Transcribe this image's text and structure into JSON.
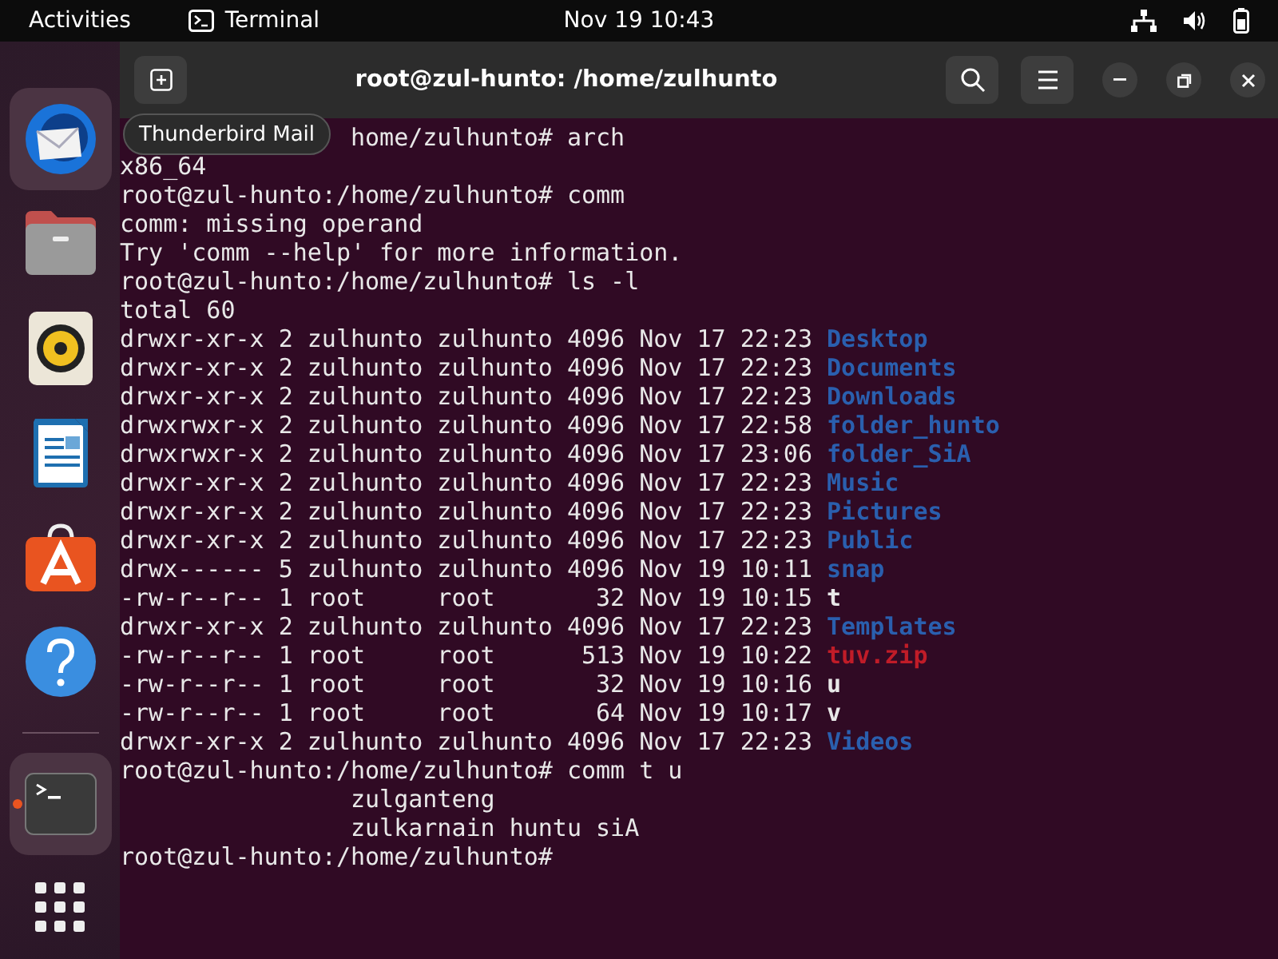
{
  "top_bar": {
    "activities": "Activities",
    "app_name": "Terminal",
    "clock": "Nov 19  10:43"
  },
  "dock": {
    "items": [
      {
        "kind": "mail",
        "highlighted": true,
        "running": false
      },
      {
        "kind": "files",
        "highlighted": false,
        "running": false
      },
      {
        "kind": "music",
        "highlighted": false,
        "running": false
      },
      {
        "kind": "writer",
        "highlighted": false,
        "running": false
      },
      {
        "kind": "store",
        "highlighted": false,
        "running": false
      },
      {
        "kind": "help",
        "highlighted": false,
        "running": false
      }
    ],
    "others": [
      {
        "kind": "terminal",
        "highlighted": true,
        "running": true
      },
      {
        "kind": "apps",
        "highlighted": false,
        "running": false
      }
    ],
    "tooltip": "Thunderbird Mail"
  },
  "window": {
    "title": "root@zul-hunto: /home/zulhunto"
  },
  "terminal": {
    "lines": [
      {
        "kind": "covered",
        "text": "home/zulhunto# arch"
      },
      {
        "kind": "plain",
        "text": "x86_64"
      },
      {
        "kind": "plain",
        "text": "root@zul-hunto:/home/zulhunto# comm"
      },
      {
        "kind": "plain",
        "text": "comm: missing operand"
      },
      {
        "kind": "plain",
        "text": "Try 'comm --help' for more information."
      },
      {
        "kind": "plain",
        "text": "root@zul-hunto:/home/zulhunto# ls -l"
      },
      {
        "kind": "plain",
        "text": "total 60"
      },
      {
        "kind": "entry",
        "text": "drwxr-xr-x 2 zulhunto zulhunto 4096 Nov 17 22:23",
        "name": "Desktop",
        "color": "#2a5fae"
      },
      {
        "kind": "entry",
        "text": "drwxr-xr-x 2 zulhunto zulhunto 4096 Nov 17 22:23",
        "name": "Documents",
        "color": "#2a5fae"
      },
      {
        "kind": "entry",
        "text": "drwxr-xr-x 2 zulhunto zulhunto 4096 Nov 17 22:23",
        "name": "Downloads",
        "color": "#2a5fae"
      },
      {
        "kind": "entry",
        "text": "drwxrwxr-x 2 zulhunto zulhunto 4096 Nov 17 22:58",
        "name": "folder_hunto",
        "color": "#2a5fae"
      },
      {
        "kind": "entry",
        "text": "drwxrwxr-x 2 zulhunto zulhunto 4096 Nov 17 23:06",
        "name": "folder_SiA",
        "color": "#2a5fae"
      },
      {
        "kind": "entry",
        "text": "drwxr-xr-x 2 zulhunto zulhunto 4096 Nov 17 22:23",
        "name": "Music",
        "color": "#2a5fae"
      },
      {
        "kind": "entry",
        "text": "drwxr-xr-x 2 zulhunto zulhunto 4096 Nov 17 22:23",
        "name": "Pictures",
        "color": "#2a5fae"
      },
      {
        "kind": "entry",
        "text": "drwxr-xr-x 2 zulhunto zulhunto 4096 Nov 17 22:23",
        "name": "Public",
        "color": "#2a5fae"
      },
      {
        "kind": "entry",
        "text": "drwx------ 5 zulhunto zulhunto 4096 Nov 19 10:11",
        "name": "snap",
        "color": "#2a5fae"
      },
      {
        "kind": "entry",
        "text": "-rw-r--r-- 1 root     root       32 Nov 19 10:15",
        "name": "t",
        "color": "#e8e8e8"
      },
      {
        "kind": "entry",
        "text": "drwxr-xr-x 2 zulhunto zulhunto 4096 Nov 17 22:23",
        "name": "Templates",
        "color": "#2a5fae"
      },
      {
        "kind": "entry",
        "text": "-rw-r--r-- 1 root     root      513 Nov 19 10:22",
        "name": "tuv.zip",
        "color": "#c01c28"
      },
      {
        "kind": "entry",
        "text": "-rw-r--r-- 1 root     root       32 Nov 19 10:16",
        "name": "u",
        "color": "#e8e8e8"
      },
      {
        "kind": "entry",
        "text": "-rw-r--r-- 1 root     root       64 Nov 19 10:17",
        "name": "v",
        "color": "#e8e8e8"
      },
      {
        "kind": "entry",
        "text": "drwxr-xr-x 2 zulhunto zulhunto 4096 Nov 17 22:23",
        "name": "Videos",
        "color": "#2a5fae"
      },
      {
        "kind": "plain",
        "text": "root@zul-hunto:/home/zulhunto# comm t u"
      },
      {
        "kind": "column3",
        "text": "zulganteng"
      },
      {
        "kind": "column3",
        "text": "zulkarnain huntu siA"
      },
      {
        "kind": "plain",
        "text": "root@zul-hunto:/home/zulhunto#"
      }
    ]
  }
}
